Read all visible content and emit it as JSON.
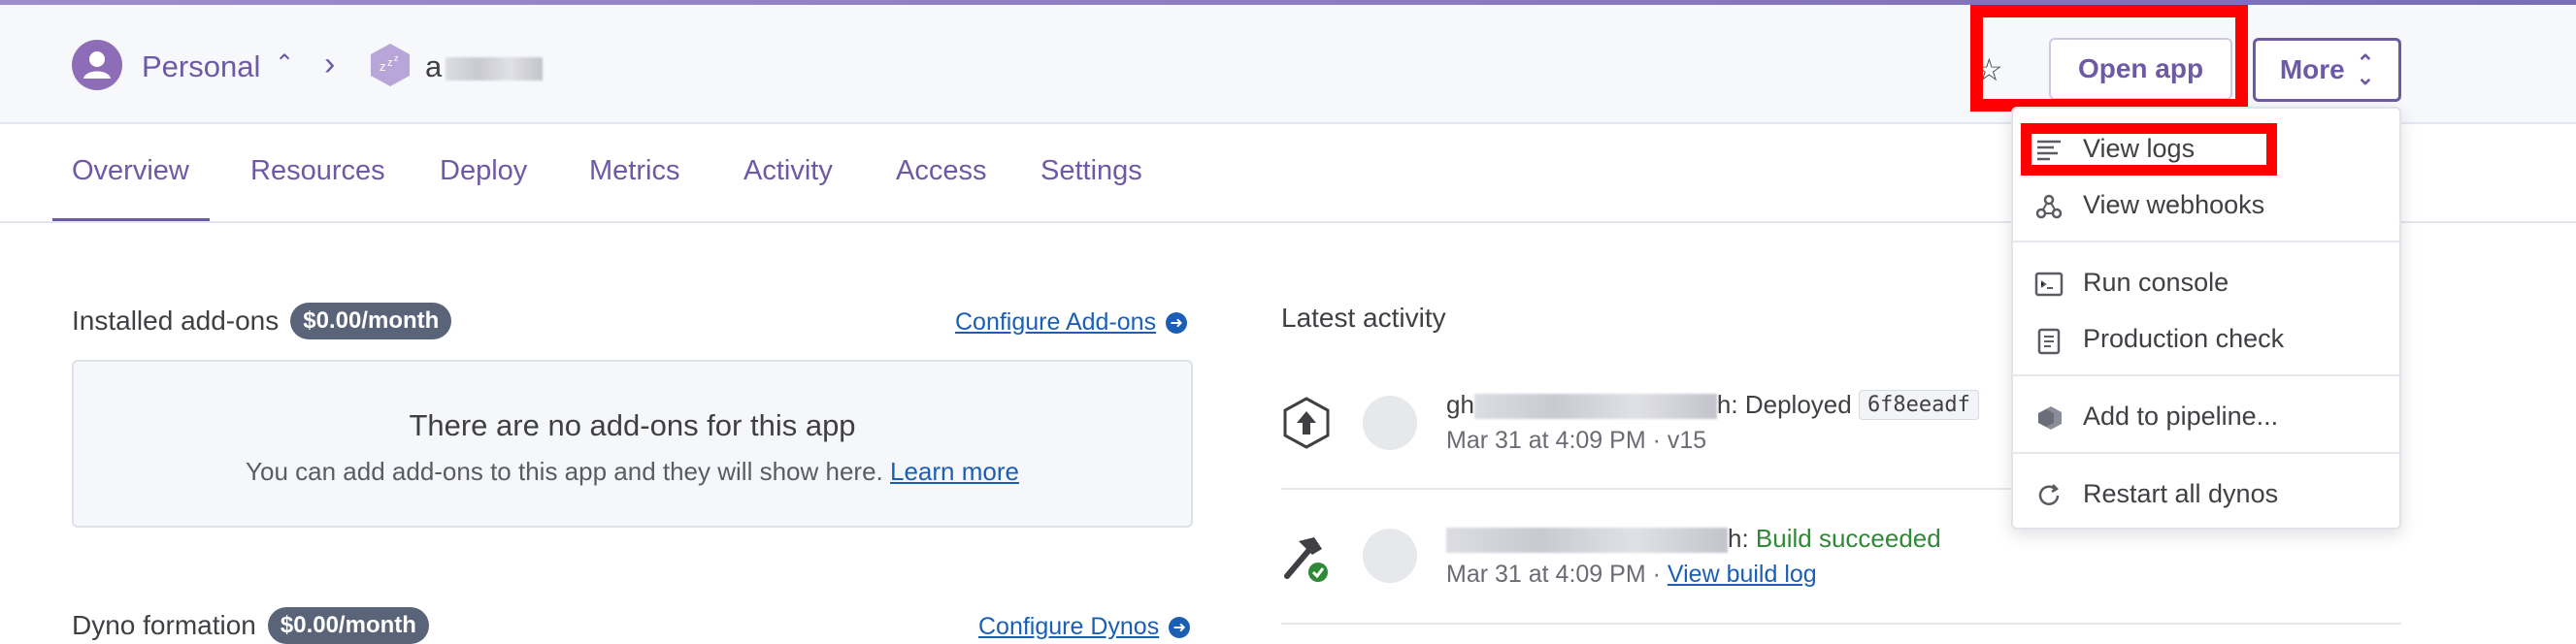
{
  "header": {
    "account_label": "Personal",
    "app_name_visible": "a",
    "open_app_label": "Open app",
    "more_label": "More"
  },
  "tabs": [
    {
      "label": "Overview"
    },
    {
      "label": "Resources"
    },
    {
      "label": "Deploy"
    },
    {
      "label": "Metrics"
    },
    {
      "label": "Activity"
    },
    {
      "label": "Access"
    },
    {
      "label": "Settings"
    }
  ],
  "addons": {
    "title": "Installed add-ons",
    "cost": "$0.00/month",
    "configure_label": "Configure Add-ons",
    "empty_title": "There are no add-ons for this app",
    "empty_desc": "You can add add-ons to this app and they will show here.",
    "learn_more": "Learn more"
  },
  "dynos": {
    "title": "Dyno formation",
    "cost": "$0.00/month",
    "configure_label": "Configure Dynos"
  },
  "activity": {
    "title": "Latest activity",
    "items": [
      {
        "user_visible": "gh",
        "action_sep": "h:",
        "action": "Deployed",
        "commit": "6f8eeadf",
        "meta": "Mar 31 at 4:09 PM · v15"
      },
      {
        "user_visible": "",
        "action_sep": "h:",
        "action": "Build succeeded",
        "meta": "Mar 31 at 4:09 PM ·",
        "link": "View build log"
      }
    ]
  },
  "more_menu": {
    "items": [
      {
        "label": "View logs",
        "icon": "logs-icon"
      },
      {
        "label": "View webhooks",
        "icon": "webhooks-icon"
      },
      {
        "label": "Run console",
        "icon": "console-icon"
      },
      {
        "label": "Production check",
        "icon": "clipboard-icon"
      },
      {
        "label": "Add to pipeline...",
        "icon": "pipeline-icon"
      },
      {
        "label": "Restart all dynos",
        "icon": "restart-icon"
      }
    ]
  },
  "colors": {
    "brand": "#6e59a6",
    "link": "#1b5fb4",
    "success": "#2e8a36",
    "highlight": "#ff0000"
  }
}
